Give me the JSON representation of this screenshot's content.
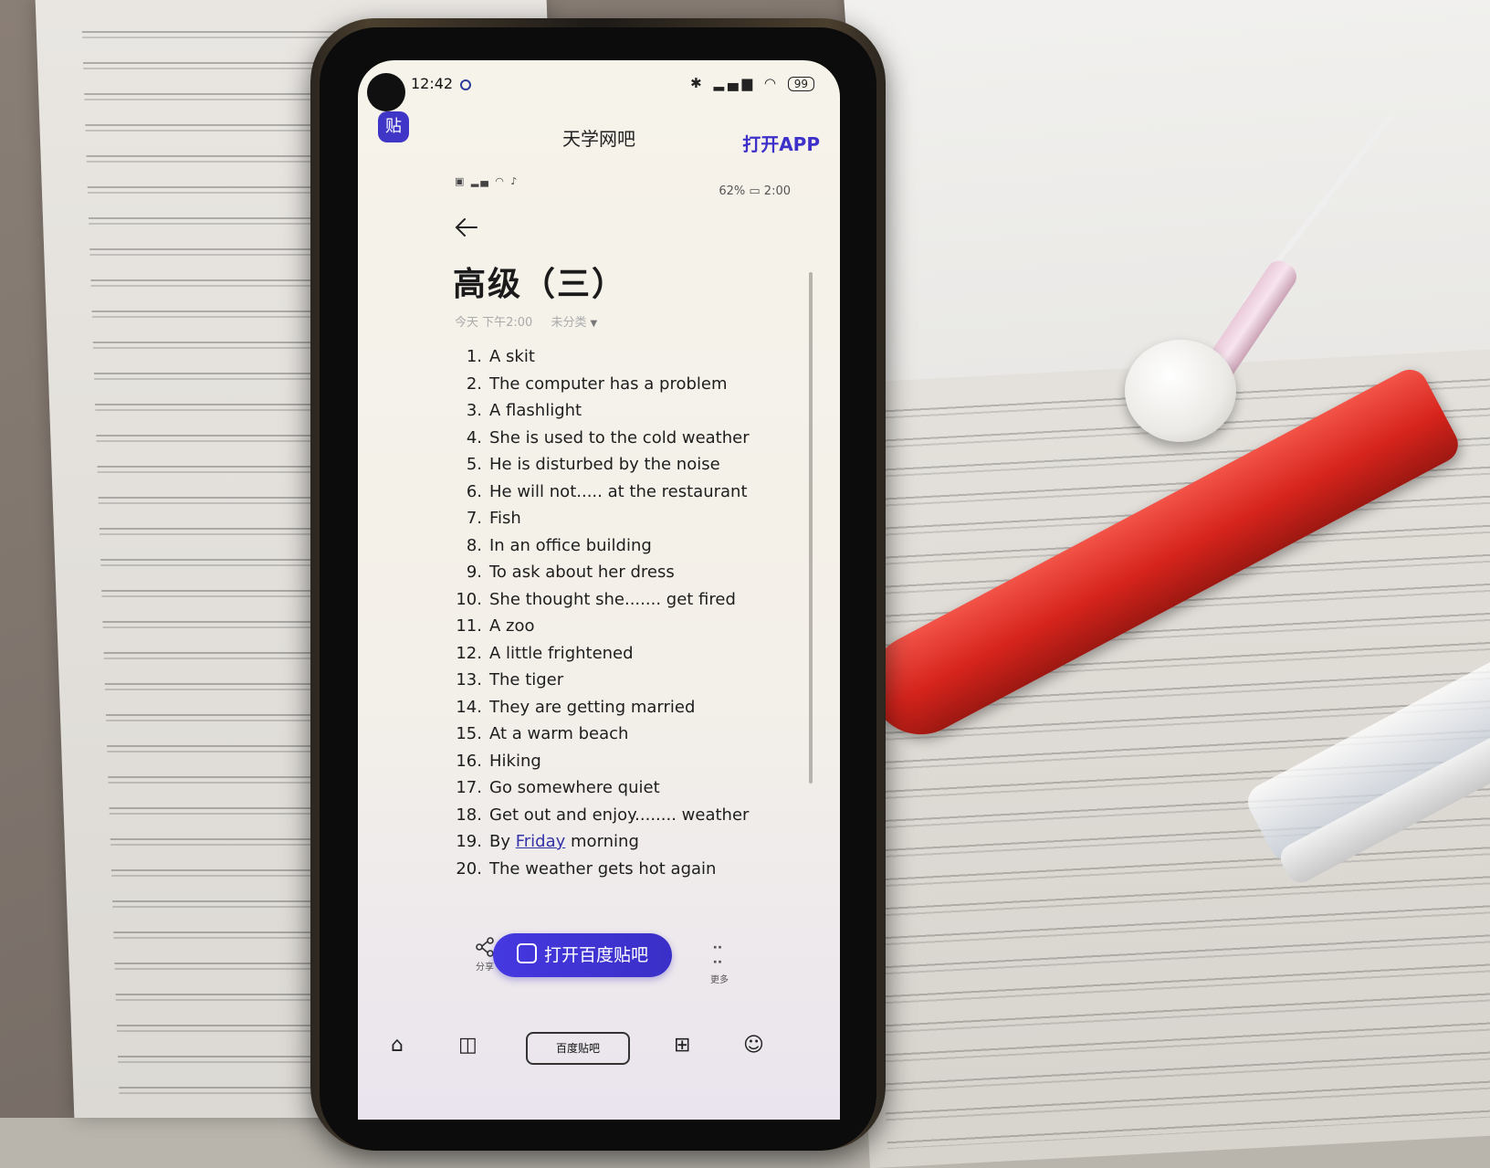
{
  "status_bar": {
    "time": "12:42",
    "battery": "99"
  },
  "header": {
    "badge": "贴",
    "site_title": "天学网吧",
    "open_app": "打开APP"
  },
  "inner_screenshot": {
    "status_right": "62%",
    "time": "2:00"
  },
  "note": {
    "title": "高级（三）",
    "date": "今天 下午2:00",
    "category": "未分类",
    "items": [
      {
        "num": "1.",
        "text": "A skit"
      },
      {
        "num": "2.",
        "text": "The computer has a problem"
      },
      {
        "num": "3.",
        "text": "A flashlight"
      },
      {
        "num": "4.",
        "text": "She is used to the cold weather"
      },
      {
        "num": "5.",
        "text": "He is disturbed by the noise"
      },
      {
        "num": "6.",
        "text": "He will not..... at the restaurant"
      },
      {
        "num": "7.",
        "text": "Fish"
      },
      {
        "num": "8.",
        "text": "In an office building"
      },
      {
        "num": "9.",
        "text": "To ask about her dress"
      },
      {
        "num": "10.",
        "text": "She thought she....... get fired"
      },
      {
        "num": "11.",
        "text": "A zoo"
      },
      {
        "num": "12.",
        "text": "A little frightened"
      },
      {
        "num": "13.",
        "text": "The tiger"
      },
      {
        "num": "14.",
        "text": "They are getting married"
      },
      {
        "num": "15.",
        "text": "At a warm beach"
      },
      {
        "num": "16.",
        "text": "Hiking"
      },
      {
        "num": "17.",
        "text": "Go somewhere quiet"
      },
      {
        "num": "18.",
        "text": "Get out and enjoy........ weather"
      },
      {
        "num": "19.",
        "text_before": "By ",
        "link": "Friday",
        "text_after": " morning"
      },
      {
        "num": "20.",
        "text": "The weather gets hot again"
      }
    ]
  },
  "actions": {
    "share_label": "分享",
    "open_tieba": "打开百度贴吧",
    "more_label": "更多"
  },
  "navbar": {
    "center_label": "百度贴吧"
  },
  "colors": {
    "brand": "#3d31c9",
    "screen_bg": "#f6f3ea"
  }
}
